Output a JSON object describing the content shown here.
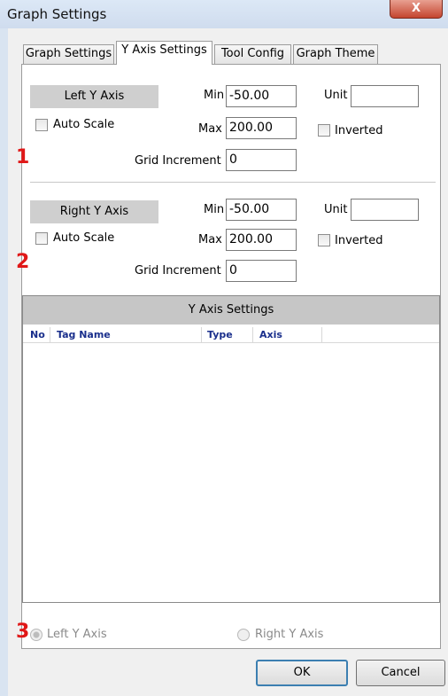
{
  "window": {
    "title": "Graph Settings",
    "close_glyph": "X"
  },
  "tabs": [
    {
      "label": "Graph Settings"
    },
    {
      "label": "Y Axis Settings"
    },
    {
      "label": "Tool Config"
    },
    {
      "label": "Graph Theme"
    }
  ],
  "left_axis": {
    "header": "Left Y Axis",
    "min_label": "Min",
    "min_value": "-50.00",
    "max_label": "Max",
    "max_value": "200.00",
    "unit_label": "Unit",
    "unit_value": "",
    "auto_scale_label": "Auto Scale",
    "inverted_label": "Inverted",
    "grid_increment_label": "Grid Increment",
    "grid_increment_value": "0"
  },
  "right_axis": {
    "header": "Right Y Axis",
    "min_label": "Min",
    "min_value": "-50.00",
    "max_label": "Max",
    "max_value": "200.00",
    "unit_label": "Unit",
    "unit_value": "",
    "auto_scale_label": "Auto Scale",
    "inverted_label": "Inverted",
    "grid_increment_label": "Grid Increment",
    "grid_increment_value": "0"
  },
  "markers": {
    "one": "1",
    "two": "2",
    "three": "3"
  },
  "grid": {
    "title": "Y Axis Settings",
    "columns": [
      "No",
      "Tag Name",
      "Type",
      "Axis"
    ],
    "rows": []
  },
  "axis_select": {
    "left_label": "Left Y Axis",
    "right_label": "Right Y Axis"
  },
  "buttons": {
    "ok": "OK",
    "cancel": "Cancel"
  }
}
